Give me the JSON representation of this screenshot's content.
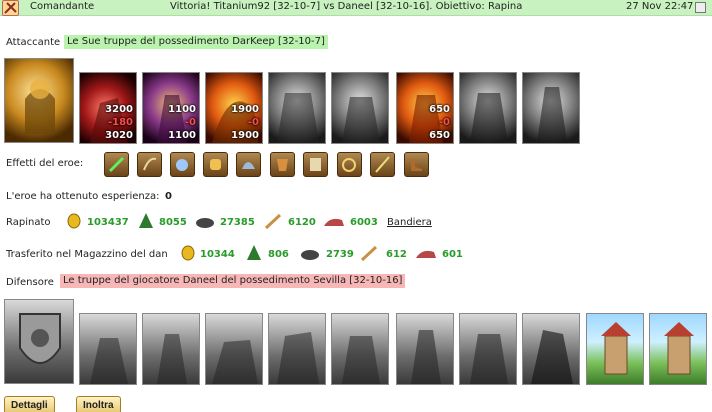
{
  "header": {
    "role": "Comandante",
    "title": "Vittoria! Titanium92 [32-10-7] vs Daneel [32-10-16]. Obiettivo: Rapina",
    "date": "27 Nov 22:47",
    "bg_color": "#c8f2c0"
  },
  "attacker": {
    "label": "Attaccante",
    "tag": "Le Sue truppe del possedimento DarKeep [32-10-7]",
    "units": [
      {
        "icon": "hero-golden-knight-portrait"
      },
      {
        "icon": "red-dragon-warrior",
        "top": "3200",
        "mid": "-180",
        "bot": "3020"
      },
      {
        "icon": "fire-mage",
        "top": "1100",
        "mid": "-0",
        "bot": "1100"
      },
      {
        "icon": "flame-beast",
        "top": "1900",
        "mid": "-0",
        "bot": "1900"
      },
      {
        "icon": "stone-gargoyle"
      },
      {
        "icon": "stone-golem"
      },
      {
        "icon": "fire-champion",
        "top": "650",
        "mid": "-0",
        "bot": "650"
      },
      {
        "icon": "horned-demon"
      },
      {
        "icon": "hooded-wraith"
      }
    ]
  },
  "hero": {
    "effects_label": "Effetti del eroe:",
    "effects": [
      "sword-icon",
      "bow-icon",
      "fist-icon",
      "gloves-icon",
      "helmet-icon",
      "armor-icon",
      "scroll-icon",
      "ring-icon",
      "staff-icon",
      "boots-icon"
    ],
    "experience_label": "L'eroe ha ottenuto esperienza:",
    "experience_value": "0"
  },
  "plunder": {
    "label": "Rapinato",
    "gold": "103437",
    "wood": "8055",
    "iron": "27385",
    "wheat": "6120",
    "meat": "6003",
    "flag_link": "Bandiera"
  },
  "transfer": {
    "label": "Trasferito nel Magazzino del dan",
    "gold": "10344",
    "wood": "806",
    "iron": "2739",
    "wheat": "612",
    "meat": "601"
  },
  "defender": {
    "label": "Difensore",
    "tag": "Le truppe del giocatore Daneel del possedimento Sevilla [32-10-16]",
    "units": [
      "crest-shield",
      "knight-rider",
      "spearman",
      "cavalry",
      "griffin-rider",
      "crossbowman",
      "hooded-monk",
      "armored-paladin",
      "dark-rider",
      "watchtower",
      "watchtower"
    ]
  },
  "buttons": {
    "details": "Dettagli",
    "forward": "Inoltra"
  },
  "colors": {
    "resource_value": "#2a9a2a",
    "attacker_tag": "#b9f3ae",
    "defender_tag": "#f7b7b7",
    "loss": "#ff4b4b"
  }
}
